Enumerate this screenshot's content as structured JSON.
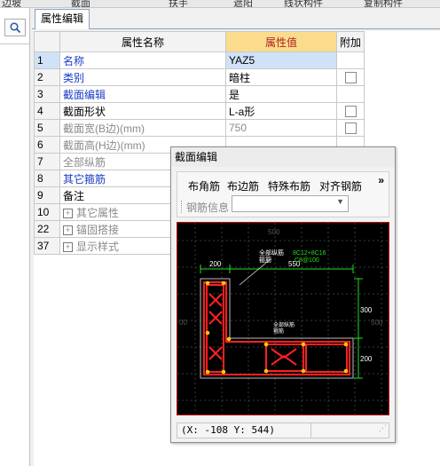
{
  "topbar": {
    "items": [
      "边坡",
      "截面",
      "扶手",
      "遮阳",
      "线状构件",
      "复制构件"
    ]
  },
  "tab": {
    "label": "属性编辑"
  },
  "table": {
    "headers": {
      "name": "属性名称",
      "value": "属性值",
      "extra": "附加"
    },
    "rows": [
      {
        "idx": "1",
        "name": "名称",
        "value": "YAZ5",
        "style": "blue",
        "checkbox": false,
        "selected": true
      },
      {
        "idx": "2",
        "name": "类别",
        "value": "暗柱",
        "style": "blue",
        "checkbox": true
      },
      {
        "idx": "3",
        "name": "截面编辑",
        "value": "是",
        "style": "blue",
        "checkbox": false
      },
      {
        "idx": "4",
        "name": "截面形状",
        "value": "L-a形",
        "style": "black",
        "checkbox": true
      },
      {
        "idx": "5",
        "name": "截面宽(B边)(mm)",
        "value": "750",
        "style": "gray",
        "checkbox": true
      },
      {
        "idx": "6",
        "name": "截面高(H边)(mm)",
        "value": "",
        "style": "gray",
        "checkbox": false
      },
      {
        "idx": "7",
        "name": "全部纵筋",
        "value": "",
        "style": "gray",
        "checkbox": false
      },
      {
        "idx": "8",
        "name": "其它箍筋",
        "value": "",
        "style": "blue",
        "checkbox": false
      },
      {
        "idx": "9",
        "name": "备注",
        "value": "",
        "style": "black",
        "checkbox": false
      },
      {
        "idx": "10",
        "name": "其它属性",
        "value": "",
        "style": "gray",
        "checkbox": false,
        "expand": true
      },
      {
        "idx": "22",
        "name": "锚固搭接",
        "value": "",
        "style": "gray",
        "checkbox": false,
        "expand": true
      },
      {
        "idx": "37",
        "name": "显示样式",
        "value": "",
        "style": "gray",
        "checkbox": false,
        "expand": true
      }
    ]
  },
  "dialog": {
    "title": "截面编辑",
    "toolbar": [
      "布角筋",
      "布边筋",
      "特殊布筋",
      "对齐钢筋"
    ],
    "more": "»",
    "rebar_info_label": "钢筋信息",
    "canvas": {
      "dims": {
        "top_left": "200",
        "top_total": "550",
        "right_top": "300",
        "right_bottom": "200",
        "grid_top": "500",
        "grid_left": "00",
        "grid_right": "500"
      },
      "annotations": {
        "rebar_all_a": "全部纵筋",
        "rebar_all_b": "箍筋",
        "rebar_all_c": "全部纵筋",
        "rebar_all_d": "箍筋",
        "green_a": "8C12+8C16",
        "green_b": "C8@100"
      }
    },
    "status": "(X: -108 Y: 544)"
  },
  "colors": {
    "grid_line": "#c8c8c8",
    "header_value_bg": "#fbdc8d",
    "header_value_text": "#b02020",
    "selected_row": "#cfe2f7",
    "rebar_red": "#ff2020",
    "dim_green": "#20e020",
    "canvas_bg": "#000000"
  }
}
